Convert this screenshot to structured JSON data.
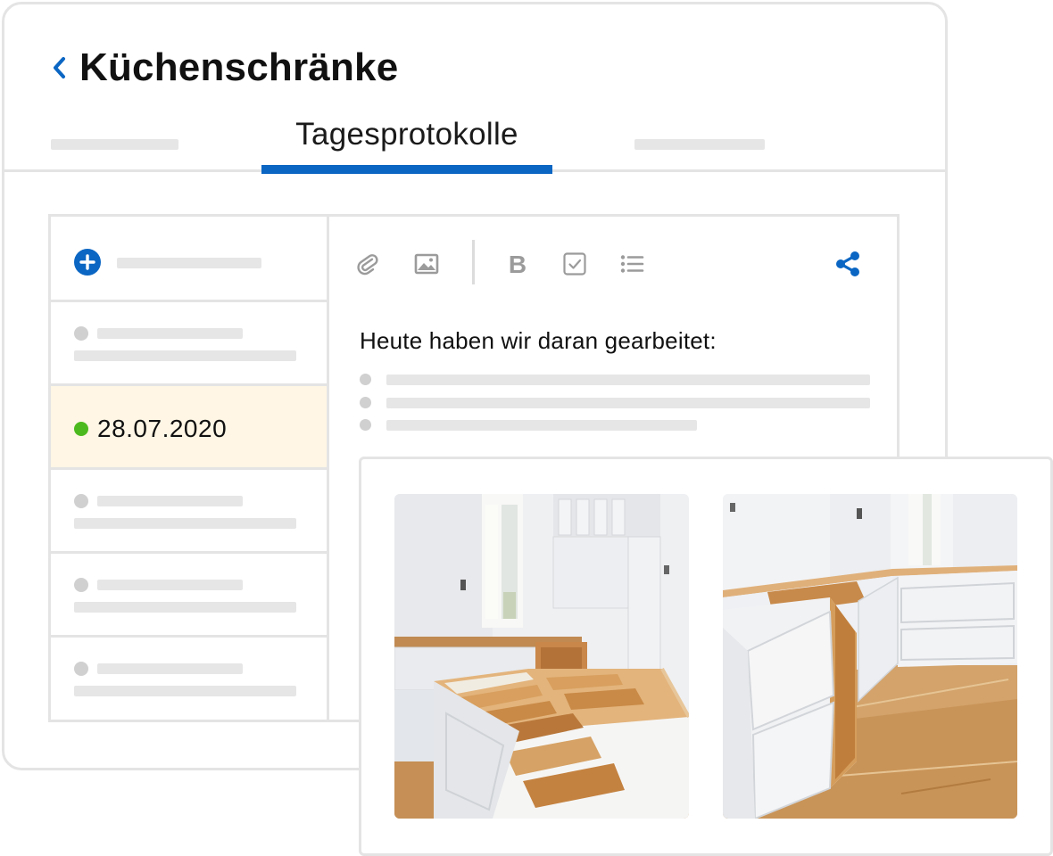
{
  "header": {
    "title": "Küchenschränke",
    "back_icon": "chevron-left-icon"
  },
  "tabs": [
    {
      "label": "",
      "state": "inactive"
    },
    {
      "label": "Tagesprotokolle",
      "state": "active"
    },
    {
      "label": "",
      "state": "inactive"
    }
  ],
  "sidebar": {
    "add_icon": "plus-circle-icon",
    "entries": [
      {
        "date": "",
        "status": "neutral"
      },
      {
        "date": "28.07.2020",
        "status": "active",
        "selected": true
      },
      {
        "date": "",
        "status": "neutral"
      },
      {
        "date": "",
        "status": "neutral"
      },
      {
        "date": "",
        "status": "neutral"
      }
    ]
  },
  "toolbar": {
    "tools": [
      "attachment-icon",
      "image-icon",
      "bold-icon",
      "checkbox-icon",
      "bulleted-list-icon"
    ],
    "share_icon": "share-icon"
  },
  "editor": {
    "heading": "Heute haben wir daran gearbeitet:"
  },
  "photos": [
    {
      "subject": "kitchen-island-cabinets-under-construction"
    },
    {
      "subject": "l-shaped-base-cabinets-under-construction"
    }
  ],
  "colors": {
    "accent": "#0b66c3",
    "status_active": "#4cba1e",
    "selected_row": "#fff6e5",
    "placeholder": "#e6e6e6",
    "border": "#e4e4e4"
  }
}
